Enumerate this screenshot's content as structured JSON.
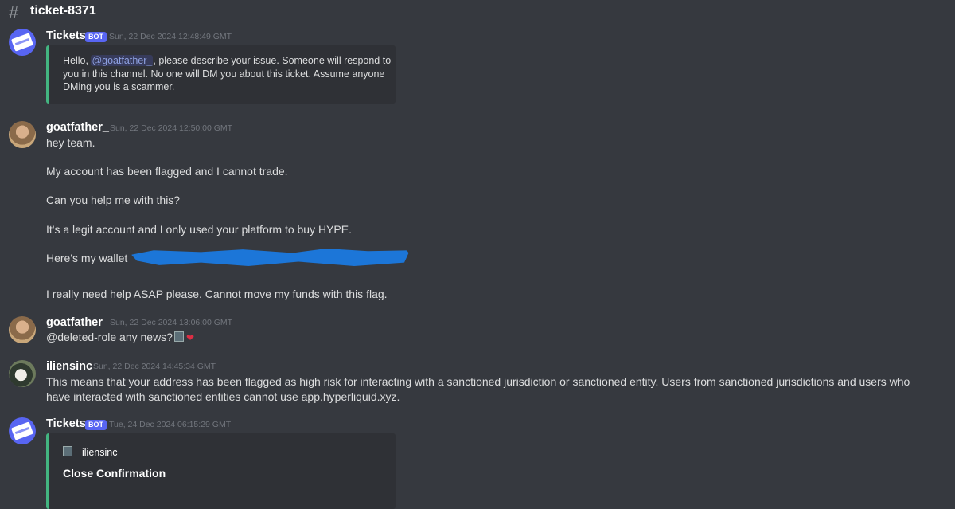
{
  "channel": {
    "name": "ticket-8371"
  },
  "messages": [
    {
      "author": "Tickets",
      "bot_tag": "BOT",
      "timestamp": "Sun, 22 Dec 2024 12:48:49 GMT",
      "embed": {
        "line1_pre": "Hello, ",
        "mention": "@goatfather_",
        "line1_post": ", please describe your issue. Someone will respond to",
        "line2": "you in this channel. No one will DM you about this ticket. Assume anyone",
        "line3": "DMing you is a scammer."
      }
    },
    {
      "author": "goatfather_",
      "timestamp": "Sun, 22 Dec 2024 12:50:00 GMT",
      "lines": [
        "hey team.",
        "My account has been flagged and I cannot trade.",
        "Can you help me with this?",
        "It's a legit account and I only used your platform to buy HYPE.",
        "Here's my wallet",
        "I really need help ASAP please. Cannot move my funds with this flag."
      ]
    },
    {
      "author": "goatfather_",
      "timestamp": "Sun, 22 Dec 2024 13:06:00 GMT",
      "text": "@deleted-role any news?",
      "emoji": "❤"
    },
    {
      "author": "iliensinc",
      "timestamp": "Sun, 22 Dec 2024 14:45:34 GMT",
      "lines": [
        "This means that your address has been flagged as high risk for interacting with a sanctioned jurisdiction or sanctioned entity. Users from sanctioned jurisdictions and users who",
        "have interacted with sanctioned entities cannot use app.hyperliquid.xyz."
      ]
    },
    {
      "author": "Tickets",
      "bot_tag": "BOT",
      "timestamp": "Tue, 24 Dec 2024 06:15:29 GMT",
      "embed": {
        "author": "iliensinc",
        "title": "Close Confirmation"
      }
    }
  ]
}
